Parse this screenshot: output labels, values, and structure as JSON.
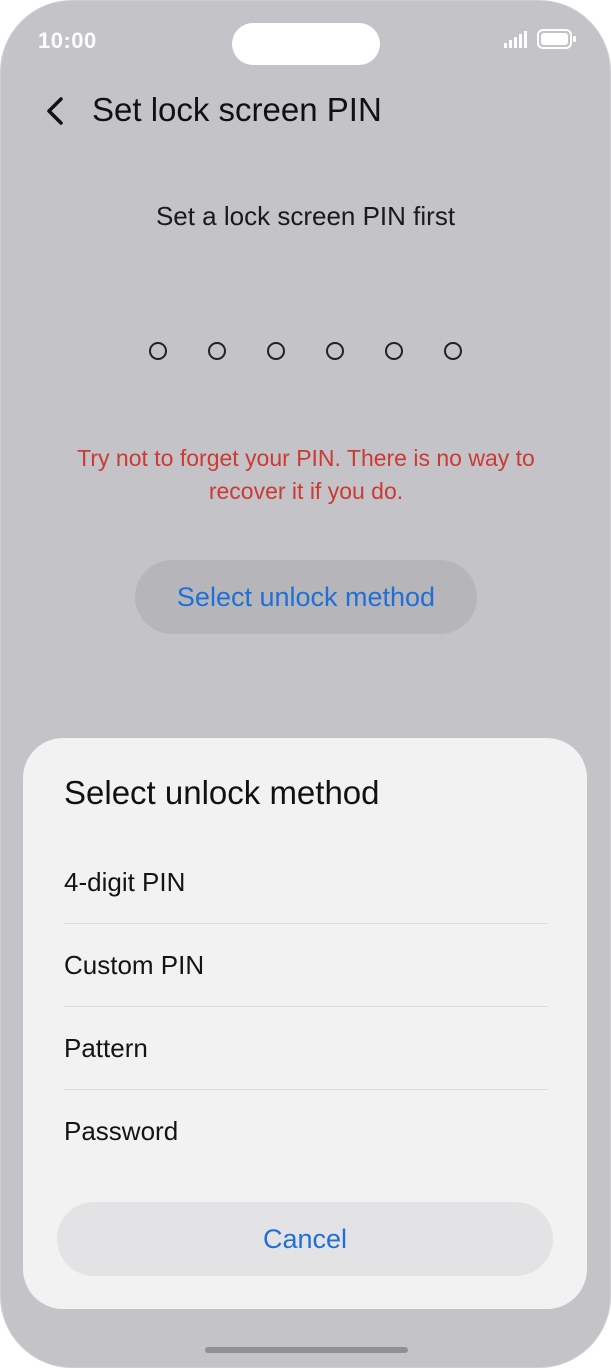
{
  "status_bar": {
    "time": "10:00"
  },
  "header": {
    "title": "Set lock screen PIN",
    "back_icon": "chevron-left-icon"
  },
  "content": {
    "subtitle": "Set a lock screen PIN first",
    "pin_length": 6,
    "pin_entered": 0,
    "warning": "Try not to forget your PIN. There is no way to recover it if you do.",
    "select_method_label": "Select unlock method"
  },
  "sheet": {
    "title": "Select unlock method",
    "options": [
      "4-digit PIN",
      "Custom PIN",
      "Pattern",
      "Password"
    ],
    "cancel_label": "Cancel"
  },
  "colors": {
    "background": "#c3c3c8",
    "accent": "#1f6fd6",
    "warning": "#cc3a33"
  }
}
